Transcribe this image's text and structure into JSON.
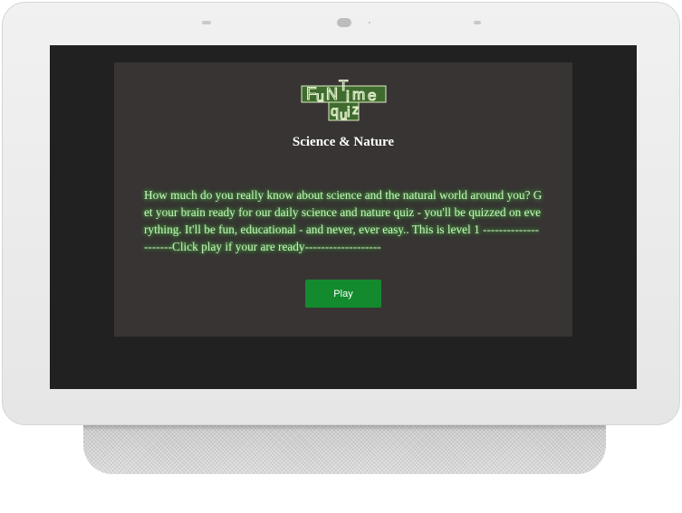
{
  "logo": {
    "text": "FunTime quiz",
    "letters": [
      "F",
      "u",
      "N",
      "T",
      "i",
      "m",
      "e",
      "q",
      "u",
      "i",
      "z"
    ],
    "colors": {
      "fill": "#3f6b2e",
      "stroke": "#dff0c4"
    }
  },
  "quiz": {
    "title": "Science & Nature",
    "description": "How much do you really know about science and the natural world around you? Get your brain ready for our daily science and nature quiz - you'll be quizzed on everything. It'll be fun, educational - and never, ever easy.. This is level 1 ---------------------Click play if your are ready-------------------",
    "play_label": "Play"
  },
  "colors": {
    "device": "#ececec",
    "screen": "#222122",
    "card": "#383434",
    "text_glow": "#56d64a",
    "play_button": "#138a2d"
  }
}
